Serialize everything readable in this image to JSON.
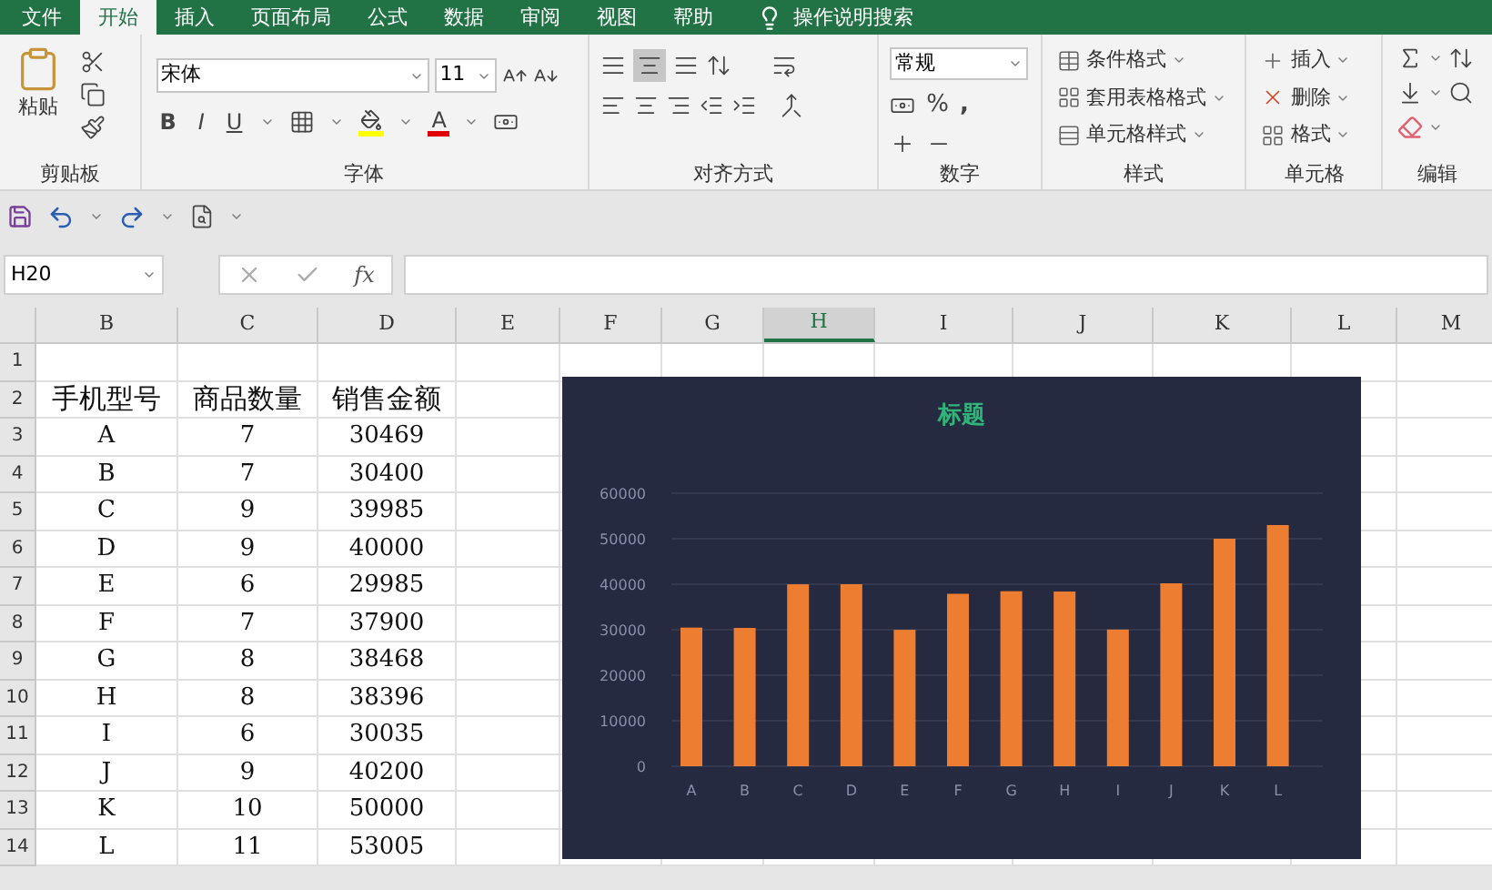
{
  "tabs": [
    {
      "label": "文件",
      "selected": false
    },
    {
      "label": "开始",
      "selected": true
    },
    {
      "label": "插入",
      "selected": false
    },
    {
      "label": "页面布局",
      "selected": false
    },
    {
      "label": "公式",
      "selected": false
    },
    {
      "label": "数据",
      "selected": false
    },
    {
      "label": "审阅",
      "selected": false
    },
    {
      "label": "视图",
      "selected": false
    },
    {
      "label": "帮助",
      "selected": false
    }
  ],
  "tell_me": "操作说明搜索",
  "ribbon": {
    "clipboard": {
      "paste": "粘贴",
      "label": "剪贴板"
    },
    "font": {
      "name": "宋体",
      "size": "11",
      "bold": "B",
      "italic": "I",
      "underline": "U",
      "font_color": "A",
      "label": "字体"
    },
    "alignment": {
      "label": "对齐方式"
    },
    "number": {
      "format": "常规",
      "percent": "%",
      "comma": ",",
      "label": "数字"
    },
    "styles": {
      "items": [
        "条件格式",
        "套用表格格式",
        "单元格样式"
      ],
      "label": "样式"
    },
    "cells": {
      "items": [
        "插入",
        "删除",
        "格式"
      ],
      "label": "单元格"
    },
    "editing": {
      "label": "编辑"
    }
  },
  "name_box": "H20",
  "fx": "fx",
  "columns": [
    {
      "label": "B",
      "selected": false
    },
    {
      "label": "C",
      "selected": false
    },
    {
      "label": "D",
      "selected": false
    },
    {
      "label": "E",
      "selected": false
    },
    {
      "label": "F",
      "selected": false
    },
    {
      "label": "G",
      "selected": false
    },
    {
      "label": "H",
      "selected": true
    },
    {
      "label": "I",
      "selected": false
    },
    {
      "label": "J",
      "selected": false
    },
    {
      "label": "K",
      "selected": false
    },
    {
      "label": "L",
      "selected": false
    },
    {
      "label": "M",
      "selected": false
    }
  ],
  "row_numbers": [
    "1",
    "2",
    "3",
    "4",
    "5",
    "6",
    "7",
    "8",
    "9",
    "10",
    "11",
    "12",
    "13",
    "14"
  ],
  "table": {
    "header": [
      "手机型号",
      "商品数量",
      "销售金额"
    ],
    "rows": [
      [
        "A",
        "7",
        "30469"
      ],
      [
        "B",
        "7",
        "30400"
      ],
      [
        "C",
        "9",
        "39985"
      ],
      [
        "D",
        "9",
        "40000"
      ],
      [
        "E",
        "6",
        "29985"
      ],
      [
        "F",
        "7",
        "37900"
      ],
      [
        "G",
        "8",
        "38468"
      ],
      [
        "H",
        "8",
        "38396"
      ],
      [
        "I",
        "6",
        "30035"
      ],
      [
        "J",
        "9",
        "40200"
      ],
      [
        "K",
        "10",
        "50000"
      ],
      [
        "L",
        "11",
        "53005"
      ]
    ]
  },
  "chart": {
    "chart_data": {
      "type": "bar",
      "title": "标题",
      "categories": [
        "A",
        "B",
        "C",
        "D",
        "E",
        "F",
        "G",
        "H",
        "I",
        "J",
        "K",
        "L"
      ],
      "grid": true,
      "series": [
        {
          "color": "#ed7d31",
          "values": [
            30469,
            30400,
            39985,
            40000,
            29985,
            37900,
            38468,
            38396,
            30035,
            40200,
            50000,
            53005
          ]
        }
      ],
      "ylim": [
        0,
        60000
      ],
      "yticks": [
        0,
        10000,
        20000,
        30000,
        40000,
        50000,
        60000
      ]
    }
  }
}
